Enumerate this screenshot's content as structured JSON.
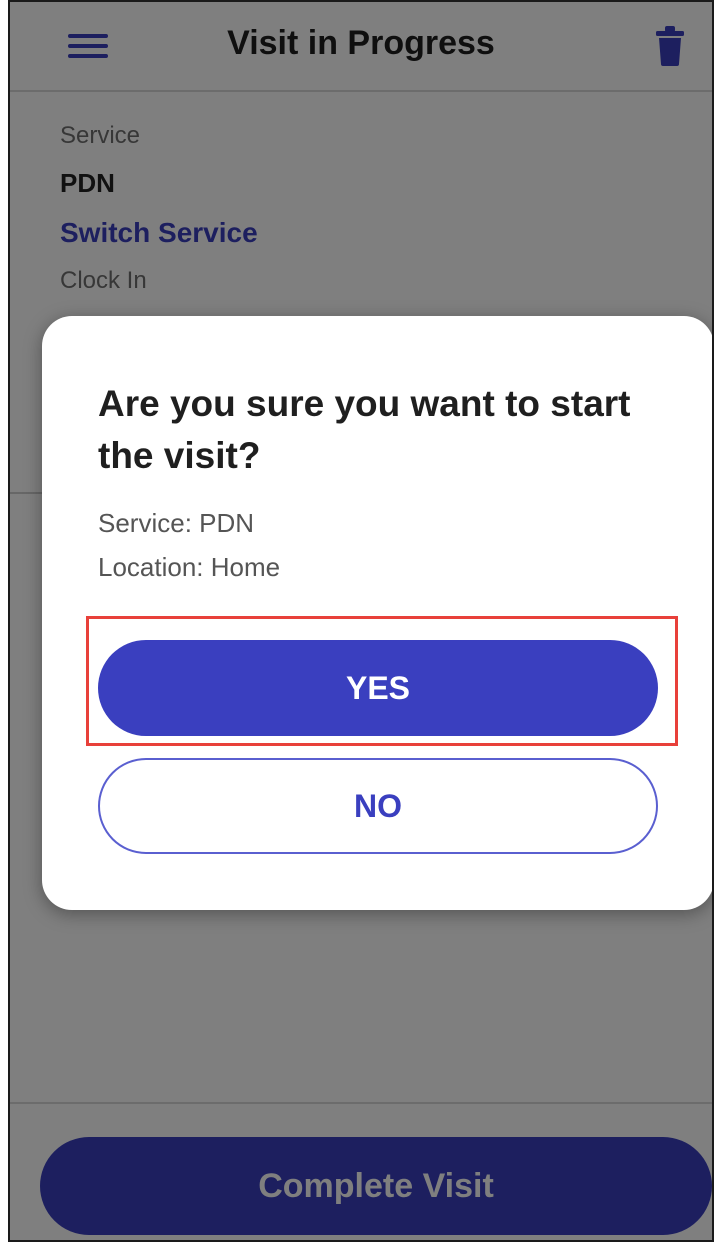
{
  "header": {
    "title": "Visit in Progress",
    "menu_icon": "hamburger-menu-icon",
    "trash_icon": "trash-icon"
  },
  "details": {
    "service_label": "Service",
    "service_value": "PDN",
    "switch_service_link": "Switch Service",
    "clock_in_label": "Clock In"
  },
  "footer": {
    "complete_visit_label": "Complete Visit"
  },
  "dialog": {
    "title": "Are you sure you want to start the visit?",
    "service_line": "Service: PDN",
    "location_line": "Location: Home",
    "yes_label": "YES",
    "no_label": "NO"
  },
  "colors": {
    "accent": "#3a3fbf",
    "highlight": "#e8403a"
  }
}
